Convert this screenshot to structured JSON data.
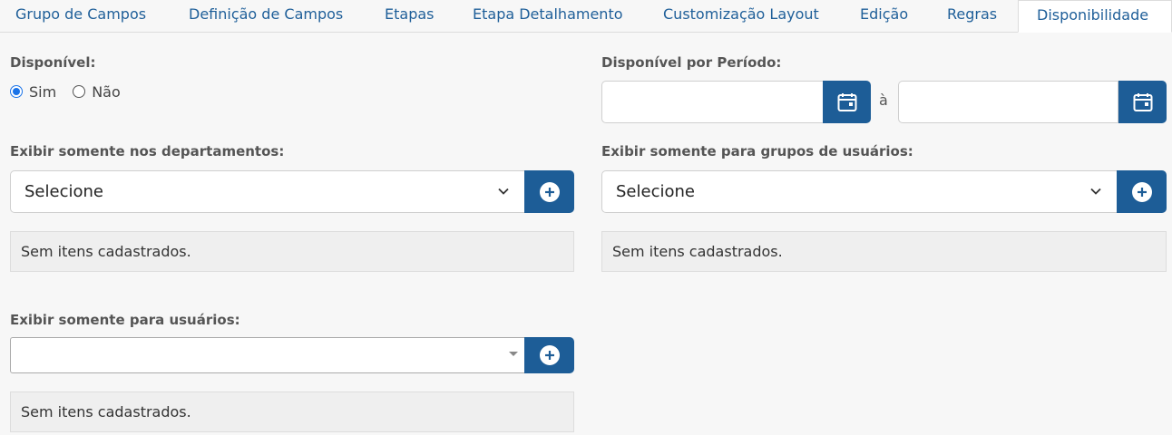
{
  "tabs": [
    {
      "label": "Grupo de Campos"
    },
    {
      "label": "Definição de Campos"
    },
    {
      "label": "Etapas"
    },
    {
      "label": "Etapa Detalhamento"
    },
    {
      "label": "Customização Layout"
    },
    {
      "label": "Edição"
    },
    {
      "label": "Regras"
    },
    {
      "label": "Disponibilidade",
      "active": true
    }
  ],
  "available": {
    "label": "Disponível:",
    "options": [
      {
        "label": "Sim",
        "checked": true
      },
      {
        "label": "Não",
        "checked": false
      }
    ]
  },
  "period": {
    "label": "Disponível por Período:",
    "separator": "à",
    "start_value": "",
    "end_value": ""
  },
  "departments": {
    "label": "Exibir somente nos departamentos:",
    "selected": "Selecione",
    "empty_text": "Sem itens cadastrados."
  },
  "user_groups": {
    "label": "Exibir somente para grupos de usuários:",
    "selected": "Selecione",
    "empty_text": "Sem itens cadastrados."
  },
  "users": {
    "label": "Exibir somente para usuários:",
    "selected": "",
    "empty_text": "Sem itens cadastrados."
  },
  "colors": {
    "accent": "#1d5d97",
    "tab_text": "#1f5f99",
    "radio_checked": "#1a73e8"
  },
  "icons": {
    "calendar": "calendar-icon",
    "add": "plus-circle-icon",
    "dropdown": "chevron-down-icon"
  }
}
